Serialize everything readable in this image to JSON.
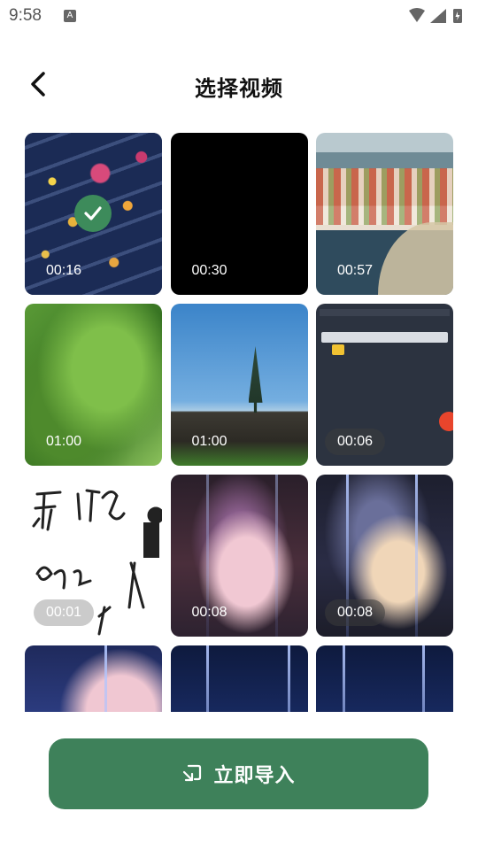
{
  "status_bar": {
    "time": "9:58",
    "notification_letter": "A"
  },
  "header": {
    "title": "选择视频"
  },
  "videos": [
    {
      "duration": "00:16",
      "selected": true
    },
    {
      "duration": "00:30",
      "selected": false
    },
    {
      "duration": "00:57",
      "selected": false
    },
    {
      "duration": "01:00",
      "selected": false
    },
    {
      "duration": "01:00",
      "selected": false
    },
    {
      "duration": "00:06",
      "selected": false
    },
    {
      "duration": "00:01",
      "selected": false
    },
    {
      "duration": "00:08",
      "selected": false
    },
    {
      "duration": "00:08",
      "selected": false
    },
    {
      "duration": "",
      "selected": false
    },
    {
      "duration": "",
      "selected": false
    },
    {
      "duration": "",
      "selected": false
    }
  ],
  "import_button": {
    "label": "立即导入",
    "icon": "import-icon"
  },
  "colors": {
    "accent": "#3e815a",
    "check": "#3d8b5b"
  }
}
